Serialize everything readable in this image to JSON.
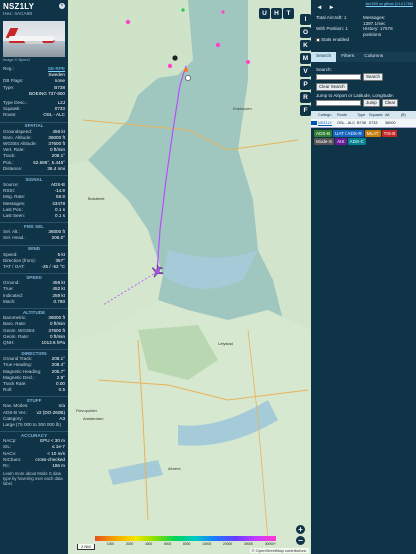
{
  "aircraft": {
    "callsign": "NSZ1LY",
    "hex_label": "Hex:",
    "hex": "4ACA88",
    "image_credit": "Image © BjornO",
    "reg": {
      "k": "Reg.:",
      "v": "SE-RPE"
    },
    "country": {
      "k": "",
      "v": "Sweden"
    },
    "db_flags": {
      "k": "DB Flags:",
      "v": "none"
    },
    "type": {
      "k": "Type:",
      "v": "B738"
    },
    "type_full": {
      "k": "",
      "v": "BOEING 737-800"
    },
    "type_desc": {
      "k": "Type Desc.:",
      "v": "L2J"
    },
    "squawk": {
      "k": "Squawk:",
      "v": "0733"
    },
    "route": {
      "k": "Route:",
      "v": "OSL - ALC"
    }
  },
  "sections": {
    "spatial": {
      "title": "SPATIAL",
      "rows": [
        {
          "k": "Groundspeed:",
          "v": "456 kt"
        },
        {
          "k": "Baro. Altitude:",
          "v": "36000 ft"
        },
        {
          "k": "WGS84 Altitude:",
          "v": "37600 ft"
        },
        {
          "k": "Vert. Rate:",
          "v": "0 ft/min"
        },
        {
          "k": "Track:",
          "v": "208.1°"
        },
        {
          "k": "Pos.:",
          "v": "52.596°, 5.445°"
        },
        {
          "k": "Distance:",
          "v": "36.4 nmi"
        }
      ]
    },
    "signal": {
      "title": "SIGNAL",
      "rows": [
        {
          "k": "Source:",
          "v": "ADS-B"
        },
        {
          "k": "RSSI:",
          "v": "-14.9"
        },
        {
          "k": "Msg. Rate:",
          "v": "56.9"
        },
        {
          "k": "Messages:",
          "v": "43478"
        },
        {
          "k": "Last Pos.:",
          "v": "0.1 s"
        },
        {
          "k": "Last Seen:",
          "v": "0.1 s"
        }
      ]
    },
    "fms": {
      "title": "FMS SEL",
      "rows": [
        {
          "k": "Sel. Alt.:",
          "v": "36000 ft"
        },
        {
          "k": "Sel. Head.:",
          "v": "206.0°"
        }
      ]
    },
    "wind": {
      "title": "WIND",
      "rows": [
        {
          "k": "Speed:",
          "v": "5 kt"
        },
        {
          "k": "Direction (from):",
          "v": "357°"
        },
        {
          "k": "TAT / OAT:",
          "v": "-25 / -52 °C"
        }
      ]
    },
    "speed": {
      "title": "SPEED",
      "rows": [
        {
          "k": "Ground:",
          "v": "456 kt"
        },
        {
          "k": "True:",
          "v": "452 kt"
        },
        {
          "k": "Indicated:",
          "v": "259 kt"
        },
        {
          "k": "Mach:",
          "v": "0.780"
        }
      ]
    },
    "altitude": {
      "title": "ALTITUDE",
      "rows": [
        {
          "k": "Barometric:",
          "v": "36000 ft"
        },
        {
          "k": "Baro. Rate:",
          "v": "0 ft/min"
        },
        {
          "k": "Geom. WGS84:",
          "v": "37600 ft"
        },
        {
          "k": "Geom. Rate:",
          "v": "0 ft/min"
        },
        {
          "k": "QNH:",
          "v": "1013.6 hPa"
        }
      ]
    },
    "direction": {
      "title": "DIRECTION",
      "rows": [
        {
          "k": "Ground Track:",
          "v": "208.1°"
        },
        {
          "k": "True Heading:",
          "v": "208.4°"
        },
        {
          "k": "Magnetic Heading:",
          "v": "205.7°"
        },
        {
          "k": "Magnetic Decl.:",
          "v": "2.9°"
        },
        {
          "k": "Track Rate:",
          "v": "0.00"
        },
        {
          "k": "Roll:",
          "v": "0.5"
        }
      ]
    },
    "stuff": {
      "title": "STUFF",
      "rows": [
        {
          "k": "Nav. Modes:",
          "v": "n/a"
        },
        {
          "k": "ADS-B Ver.:",
          "v": "v2 (DO-260B)"
        },
        {
          "k": "Category:",
          "v": "A3"
        },
        {
          "k": "Large (75 000 to 300 000 lb)",
          "v": ""
        }
      ]
    },
    "accuracy": {
      "title": "ACCURACY",
      "rows": [
        {
          "k": "NACp:",
          "v": "EPU < 30 m"
        },
        {
          "k": "SIL:",
          "v": "≤ 1e-7"
        },
        {
          "k": "NACv:",
          "v": "< 10 m/s"
        },
        {
          "k": "NICbaro:",
          "v": "cross-checked"
        },
        {
          "k": "Rc:",
          "v": "186 m"
        }
      ]
    },
    "note": "Learn more about Mode S data type by hovering over each data label."
  },
  "map": {
    "top_buttons": [
      "U",
      "H",
      "T"
    ],
    "side_buttons": [
      "I",
      "O",
      "K",
      "M",
      "V",
      "P",
      "R",
      "F"
    ],
    "zoom_in": "+",
    "zoom_out": "−",
    "scale": "2 NM",
    "attribution": "© OpenStreetMap contributors.",
    "alt_labels": [
      "",
      "1000",
      "2000",
      "4000",
      "6000",
      "8000",
      "10000",
      "20000",
      "30000",
      "40000+"
    ],
    "place_labels": [
      "Bulsbeek",
      "Enkhuizen",
      "Lelystad",
      "Amsterdam",
      "Almere",
      "Flevopolder"
    ],
    "accent": "#b84dff"
  },
  "sidebar": {
    "top_link": "tar1090 on github (3.14.1756)",
    "total_aircraft_label": "Total Aircraft:",
    "total_aircraft": "1",
    "messages_label": "Messages:",
    "messages": "1397.1/sec",
    "with_position_label": "With Position:",
    "with_position": "1",
    "history_label": "History:",
    "history": "17578 positions",
    "stats_label": "Stats enabled",
    "tabs": [
      "Search",
      "Filters",
      "Columns"
    ],
    "search_label": "Search:",
    "search_btn": "Search",
    "clear_search": "Clear Search",
    "jump_label": "Jump to Airport or Latitude, Longitude:",
    "jump_btn": "Jump",
    "clear_btn": "Clear",
    "table_headers": [
      "",
      "Callsign",
      "Route",
      "Type",
      "Squawk",
      "Alt.",
      "(ft)"
    ],
    "table_row": [
      "",
      "NSZ1LY",
      "OSL - ALC",
      "B738",
      "0733",
      "36000",
      ""
    ],
    "source_chips": [
      {
        "label": "ADS-B",
        "color": "#2e7d32"
      },
      {
        "label": "UAT / ADS-R",
        "color": "#1565c0"
      },
      {
        "label": "MLAT",
        "color": "#c77d0a"
      },
      {
        "label": "TIS-B",
        "color": "#c62828"
      },
      {
        "label": "Mode-S",
        "color": "#555555"
      },
      {
        "label": "AIS",
        "color": "#6a1b9a"
      },
      {
        "label": "ADS-C",
        "color": "#00838f"
      }
    ]
  }
}
